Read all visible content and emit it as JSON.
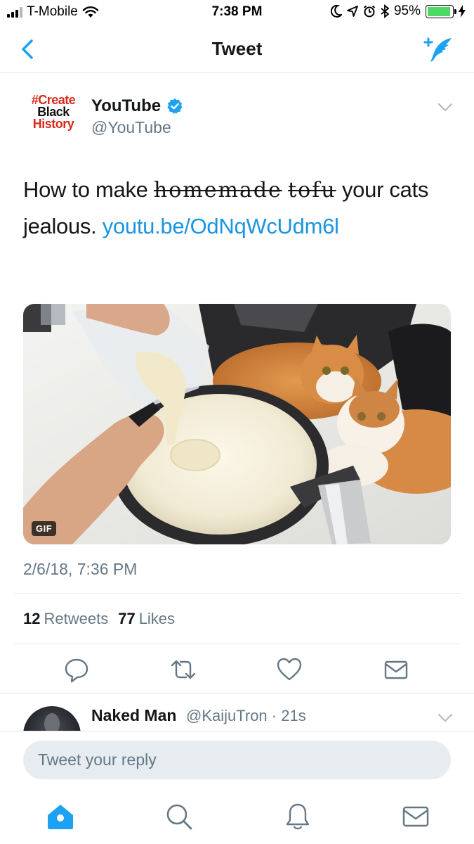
{
  "status_bar": {
    "carrier": "T-Mobile",
    "time": "7:38 PM",
    "battery_percent": "95%",
    "icons": [
      "signal-icon",
      "wifi-icon",
      "moon-icon",
      "location-icon",
      "alarm-icon",
      "bluetooth-icon",
      "battery-icon",
      "charging-icon"
    ]
  },
  "nav": {
    "title": "Tweet",
    "back_icon": "back-chevron-icon",
    "compose_icon": "compose-tweet-icon",
    "accent_color": "#1da1f2"
  },
  "tweet": {
    "author": {
      "avatar_lines": [
        "#Create",
        "Black",
        "History"
      ],
      "name": "YouTube",
      "handle": "@YouTube",
      "verified": true
    },
    "text": {
      "prefix": "How to make ",
      "strike_1": "homemade",
      "strike_2": "tofu",
      "middle": " your cats jealous. ",
      "link": "youtu.be/​OdNqWcUdm6l"
    },
    "media_badge": "GIF",
    "timestamp": "2/6/18, 7:36 PM",
    "stats": {
      "retweets_count": "12",
      "retweets_label": "Retweets",
      "likes_count": "77",
      "likes_label": "Likes"
    },
    "actions": [
      "reply-icon",
      "retweet-icon",
      "like-icon",
      "direct-message-icon"
    ]
  },
  "reply": {
    "name": "Naked Man",
    "handle": "@KaijuTron · 21s"
  },
  "composer": {
    "placeholder": "Tweet your reply"
  },
  "tab_bar": {
    "tabs": [
      "home-icon",
      "search-icon",
      "notifications-icon",
      "messages-icon"
    ]
  }
}
